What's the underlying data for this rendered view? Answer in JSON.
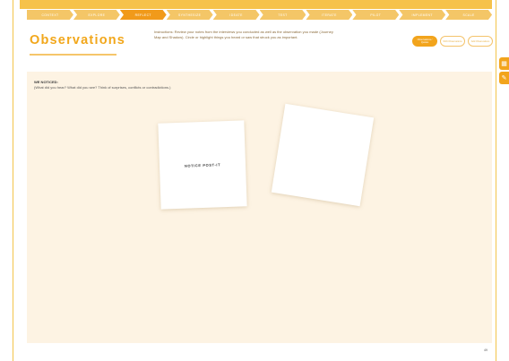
{
  "steps": [
    {
      "label": "Context"
    },
    {
      "label": "Explore"
    },
    {
      "label": "Reflect"
    },
    {
      "label": "Synthesize"
    },
    {
      "label": "Ideate"
    },
    {
      "label": "Test"
    },
    {
      "label": "Iterate"
    },
    {
      "label": "Pilot"
    },
    {
      "label": "Implement"
    },
    {
      "label": "Scale"
    }
  ],
  "active_step": "Reflect",
  "page": {
    "title": "Observations",
    "instructions": "Instructions: Review your notes from the interviews you conducted as well as the observation you made (Journey Map and Shadow). Circle or highlight things you heard or saw that struck you as important."
  },
  "view_buttons": [
    {
      "label": "Observations / Quotes",
      "active": true
    },
    {
      "label": "Shift Observations",
      "active": false
    },
    {
      "label": "Add Observations",
      "active": false
    }
  ],
  "side_tabs": [
    {
      "icon": "grid-icon",
      "glyph": "▦"
    },
    {
      "icon": "pencil-icon",
      "glyph": "✎"
    }
  ],
  "canvas": {
    "heading": "WE NOTICED:",
    "subtext": "(What did you hear? What did you see? Think of surprises, conflicts or contradictions.)",
    "notes": [
      {
        "text": "NOTICE POST-IT"
      },
      {
        "text": ""
      }
    ]
  },
  "page_number": "49",
  "colors": {
    "accent": "#f2a41c",
    "canvas_bg": "#fdf3e3",
    "title": "#f2a71b"
  }
}
